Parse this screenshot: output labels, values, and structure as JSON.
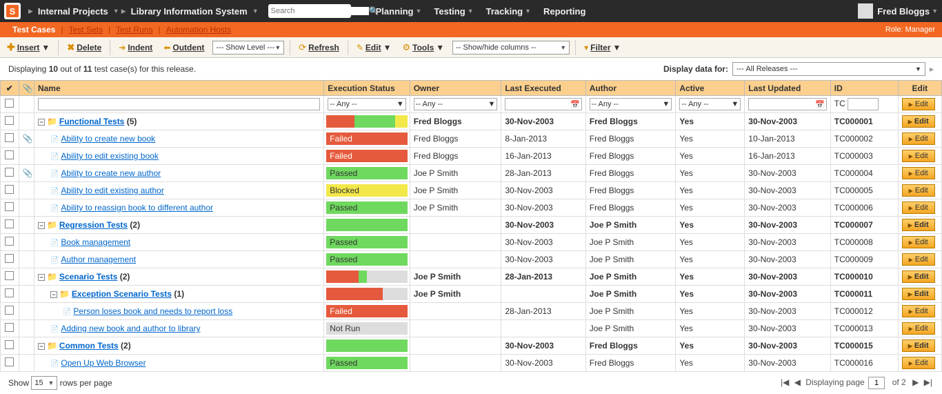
{
  "topbar": {
    "breadcrumb1": "Internal Projects",
    "breadcrumb2": "Library Information System",
    "search_placeholder": "Search",
    "menu": [
      "Planning",
      "Testing",
      "Tracking",
      "Reporting"
    ],
    "user": "Fred Bloggs"
  },
  "tabs": {
    "items": [
      "Test Cases",
      "Test Sets",
      "Test Runs",
      "Automation Hosts"
    ],
    "role": "Role: Manager"
  },
  "toolbar": {
    "insert": "Insert",
    "delete": "Delete",
    "indent": "Indent",
    "outdent": "Outdent",
    "showlevel": "--- Show Level ---",
    "refresh": "Refresh",
    "edit": "Edit",
    "tools": "Tools",
    "showhide": "-- Show/hide columns --",
    "filter": "Filter"
  },
  "info": {
    "pre": "Displaying ",
    "shown": "10",
    "mid": " out of ",
    "total": "11",
    "post": " test case(s) for this release.",
    "display_for": "Display data for:",
    "release": "--- All Releases ---"
  },
  "columns": {
    "name": "Name",
    "status": "Execution Status",
    "owner": "Owner",
    "last_exec": "Last Executed",
    "author": "Author",
    "active": "Active",
    "updated": "Last Updated",
    "id": "ID",
    "edit": "Edit"
  },
  "filters": {
    "any": "-- Any --",
    "id_prefix": "TC"
  },
  "rows": [
    {
      "type": "folder",
      "level": 0,
      "name": "Functional Tests",
      "count": "(5)",
      "status_bar": [
        [
          "#e55a3c",
          35
        ],
        [
          "#6fd95f",
          50
        ],
        [
          "#f3e84a",
          15
        ]
      ],
      "owner": "Fred Bloggs",
      "last_exec": "30-Nov-2003",
      "author": "Fred Bloggs",
      "active": "Yes",
      "updated": "30-Nov-2003",
      "id": "TC000001"
    },
    {
      "type": "leaf",
      "level": 1,
      "att": true,
      "name": "Ability to create new book",
      "status": "Failed",
      "owner": "Fred Bloggs",
      "last_exec": "8-Jan-2013",
      "author": "Fred Bloggs",
      "active": "Yes",
      "updated": "10-Jan-2013",
      "id": "TC000002"
    },
    {
      "type": "leaf",
      "level": 1,
      "name": "Ability to edit existing book",
      "status": "Failed",
      "owner": "Fred Bloggs",
      "last_exec": "16-Jan-2013",
      "author": "Fred Bloggs",
      "active": "Yes",
      "updated": "16-Jan-2013",
      "id": "TC000003"
    },
    {
      "type": "leaf",
      "level": 1,
      "att": true,
      "name": "Ability to create new author",
      "status": "Passed",
      "owner": "Joe P Smith",
      "last_exec": "28-Jan-2013",
      "author": "Fred Bloggs",
      "active": "Yes",
      "updated": "30-Nov-2003",
      "id": "TC000004"
    },
    {
      "type": "leaf",
      "level": 1,
      "name": "Ability to edit existing author",
      "status": "Blocked",
      "owner": "Joe P Smith",
      "last_exec": "30-Nov-2003",
      "author": "Fred Bloggs",
      "active": "Yes",
      "updated": "30-Nov-2003",
      "id": "TC000005"
    },
    {
      "type": "leaf",
      "level": 1,
      "name": "Ability to reassign book to different author",
      "status": "Passed",
      "owner": "Joe P Smith",
      "last_exec": "30-Nov-2003",
      "author": "Fred Bloggs",
      "active": "Yes",
      "updated": "30-Nov-2003",
      "id": "TC000006"
    },
    {
      "type": "folder",
      "level": 0,
      "name": "Regression Tests",
      "count": "(2)",
      "status_bar": [
        [
          "#6fd95f",
          100
        ]
      ],
      "owner": "",
      "last_exec": "30-Nov-2003",
      "author": "Joe P Smith",
      "active": "Yes",
      "updated": "30-Nov-2003",
      "id": "TC000007"
    },
    {
      "type": "leaf",
      "level": 1,
      "name": "Book management",
      "status": "Passed",
      "owner": "",
      "last_exec": "30-Nov-2003",
      "author": "Joe P Smith",
      "active": "Yes",
      "updated": "30-Nov-2003",
      "id": "TC000008"
    },
    {
      "type": "leaf",
      "level": 1,
      "name": "Author management",
      "status": "Passed",
      "owner": "",
      "last_exec": "30-Nov-2003",
      "author": "Joe P Smith",
      "active": "Yes",
      "updated": "30-Nov-2003",
      "id": "TC000009"
    },
    {
      "type": "folder",
      "level": 0,
      "name": "Scenario Tests",
      "count": "(2)",
      "status_bar": [
        [
          "#e55a3c",
          40
        ],
        [
          "#6fd95f",
          10
        ],
        [
          "#ddd",
          50
        ]
      ],
      "owner": "Joe P Smith",
      "last_exec": "28-Jan-2013",
      "author": "Joe P Smith",
      "active": "Yes",
      "updated": "30-Nov-2003",
      "id": "TC000010"
    },
    {
      "type": "folder",
      "level": 1,
      "name": "Exception Scenario Tests",
      "count": "(1)",
      "status_bar": [
        [
          "#e55a3c",
          70
        ],
        [
          "#ddd",
          30
        ]
      ],
      "owner": "Joe P Smith",
      "last_exec": "",
      "author": "Joe P Smith",
      "active": "Yes",
      "updated": "30-Nov-2003",
      "id": "TC000011"
    },
    {
      "type": "leaf",
      "level": 2,
      "name": "Person loses book and needs to report loss",
      "status": "Failed",
      "owner": "",
      "last_exec": "28-Jan-2013",
      "author": "Joe P Smith",
      "active": "Yes",
      "updated": "30-Nov-2003",
      "id": "TC000012"
    },
    {
      "type": "leaf",
      "level": 1,
      "name": "Adding new book and author to library",
      "status": "Not Run",
      "owner": "",
      "last_exec": "",
      "author": "Joe P Smith",
      "active": "Yes",
      "updated": "30-Nov-2003",
      "id": "TC000013"
    },
    {
      "type": "folder",
      "level": 0,
      "name": "Common Tests",
      "count": "(2)",
      "status_bar": [
        [
          "#6fd95f",
          100
        ]
      ],
      "owner": "",
      "last_exec": "30-Nov-2003",
      "author": "Fred Bloggs",
      "active": "Yes",
      "updated": "30-Nov-2003",
      "id": "TC000015"
    },
    {
      "type": "leaf",
      "level": 1,
      "name": "Open Up Web Browser",
      "status": "Passed",
      "owner": "",
      "last_exec": "30-Nov-2003",
      "author": "Fred Bloggs",
      "active": "Yes",
      "updated": "30-Nov-2003",
      "id": "TC000016"
    }
  ],
  "edit_label": "Edit",
  "footer": {
    "show": "Show",
    "rows_per": "rows per page",
    "page_size": "15",
    "displaying": "Displaying page",
    "page": "1",
    "of": "of 2"
  }
}
